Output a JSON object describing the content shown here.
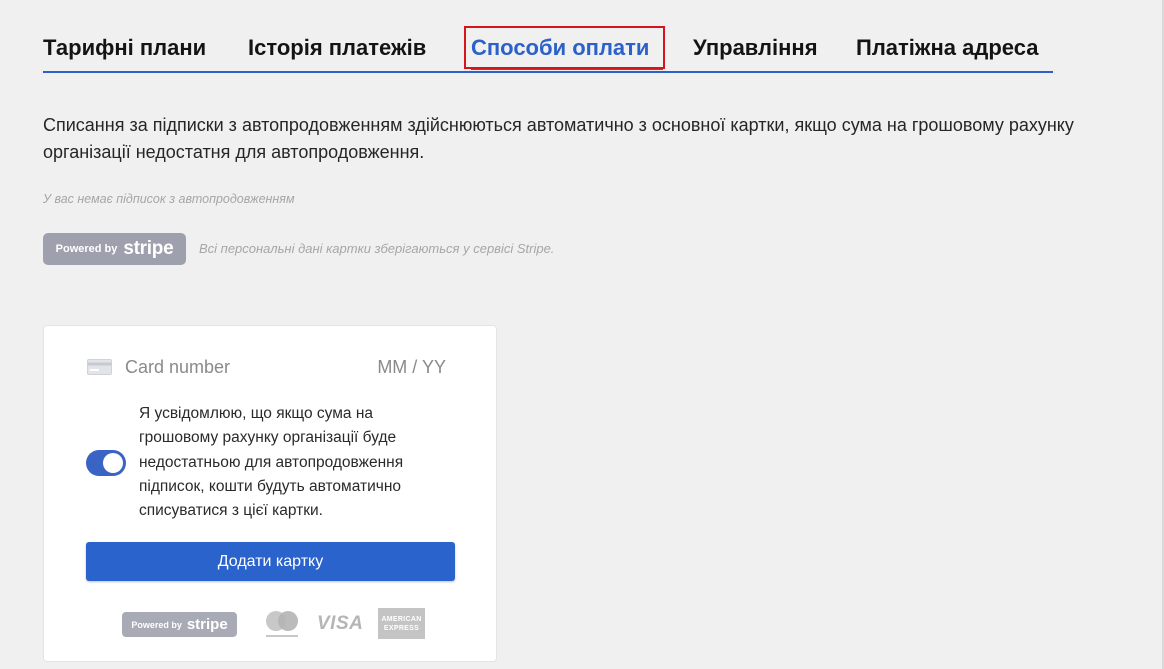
{
  "tabs": [
    {
      "label": "Тарифні плани",
      "active": false
    },
    {
      "label": "Історія платежів",
      "active": false
    },
    {
      "label": "Способи оплати",
      "active": true
    },
    {
      "label": "Управління",
      "active": false
    },
    {
      "label": "Платіжна адреса",
      "active": false
    }
  ],
  "info_text": "Списання за підписки з автопродовженням здійснюються автоматично з основної картки, якщо сума на грошовому рахунку організації недостатня для автопродовження.",
  "no_subscriptions_text": "У вас немає підписок з автопродовженням",
  "stripe_badge": {
    "prefix": "Powered by",
    "brand": "stripe"
  },
  "stripe_note": "Всі персональні дані картки зберігаються у сервісі Stripe.",
  "card_form": {
    "card_number_placeholder": "Card number",
    "expiry_placeholder": "MM / YY",
    "consent_text": "Я усвідомлюю, що якщо сума на грошовому рахунку організації буде недостатньою для автопродовження підписок, кошти будуть автоматично списуватися з цієї картки.",
    "consent_enabled": true,
    "add_button_label": "Додати картку",
    "footer": {
      "badge_prefix": "Powered by",
      "badge_brand": "stripe",
      "card_brands": [
        "mastercard-icon",
        "visa-icon",
        "amex-icon"
      ],
      "visa_text": "VISA",
      "amex_line1": "AMERICAN",
      "amex_line2": "EXPRESS"
    }
  },
  "colors": {
    "accent": "#2b61c9",
    "highlight": "#d8141b",
    "background": "#f0f0f0",
    "button": "#2b63cc"
  }
}
